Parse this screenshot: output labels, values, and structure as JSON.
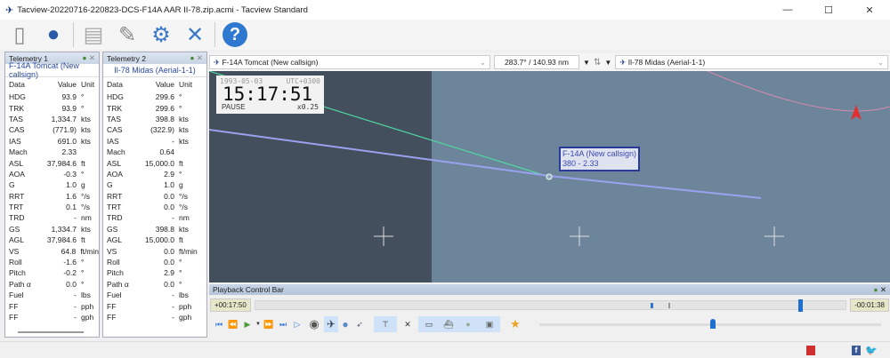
{
  "window": {
    "title": "Tacview-20220716-220823-DCS-F14A AAR II-78.zip.acmi - Tacview Standard",
    "minimize": "—",
    "maximize": "☐",
    "close": "✕"
  },
  "toolbar": [
    {
      "icon": "usb-drive-icon",
      "glyph": "🗄"
    },
    {
      "icon": "globe-icon",
      "glyph": "🌐"
    },
    {
      "icon": "document-icon",
      "glyph": "📄"
    },
    {
      "icon": "notepad-icon",
      "glyph": "📝"
    },
    {
      "icon": "gear-icon",
      "glyph": "⚙"
    },
    {
      "icon": "tools-icon",
      "glyph": "🛠"
    },
    {
      "icon": "help-icon",
      "glyph": "?"
    }
  ],
  "telemetry": [
    {
      "title": "Telemetry 1",
      "object": "F-14A Tomcat (New callsign)",
      "cols": [
        "Data",
        "Value",
        "Unit"
      ],
      "rows": [
        [
          "HDG",
          "93.9",
          "°"
        ],
        [
          "TRK",
          "93.9",
          "°"
        ],
        [
          "TAS",
          "1,334.7",
          "kts"
        ],
        [
          "CAS",
          "(771.9)",
          "kts"
        ],
        [
          "IAS",
          "691.0",
          "kts"
        ],
        [
          "Mach",
          "2.33",
          ""
        ],
        [
          "ASL",
          "37,984.6",
          "ft"
        ],
        [
          "AOA",
          "-0.3",
          "°"
        ],
        [
          "G",
          "1.0",
          "g"
        ],
        [
          "RRT",
          "1.6",
          "°/s"
        ],
        [
          "TRT",
          "0.1",
          "°/s"
        ],
        [
          "TRD",
          "-",
          "nm"
        ],
        [
          "GS",
          "1,334.7",
          "kts"
        ],
        [
          "AGL",
          "37,984.6",
          "ft"
        ],
        [
          "VS",
          "64.8",
          "ft/min"
        ],
        [
          "Roll",
          "-1.6",
          "°"
        ],
        [
          "Pitch",
          "-0.2",
          "°"
        ],
        [
          "Path α",
          "0.0",
          "°"
        ],
        [
          "Fuel",
          "-",
          "lbs"
        ],
        [
          "FF",
          "-",
          "pph"
        ],
        [
          "FF",
          "-",
          "gph"
        ]
      ]
    },
    {
      "title": "Telemetry 2",
      "object": "Il-78 Midas (Aerial-1-1)",
      "cols": [
        "Data",
        "Value",
        "Unit"
      ],
      "rows": [
        [
          "HDG",
          "299.6",
          "°"
        ],
        [
          "TRK",
          "299.6",
          "°"
        ],
        [
          "TAS",
          "398.8",
          "kts"
        ],
        [
          "CAS",
          "(322.9)",
          "kts"
        ],
        [
          "IAS",
          "-",
          "kts"
        ],
        [
          "Mach",
          "0.64",
          ""
        ],
        [
          "ASL",
          "15,000.0",
          "ft"
        ],
        [
          "AOA",
          "2.9",
          "°"
        ],
        [
          "G",
          "1.0",
          "g"
        ],
        [
          "RRT",
          "0.0",
          "°/s"
        ],
        [
          "TRT",
          "0.0",
          "°/s"
        ],
        [
          "TRD",
          "-",
          "nm"
        ],
        [
          "GS",
          "398.8",
          "kts"
        ],
        [
          "AGL",
          "15,000.0",
          "ft"
        ],
        [
          "VS",
          "0.0",
          "ft/min"
        ],
        [
          "Roll",
          "0.0",
          "°"
        ],
        [
          "Pitch",
          "2.9",
          "°"
        ],
        [
          "Path α",
          "0.0",
          "°"
        ],
        [
          "Fuel",
          "-",
          "lbs"
        ],
        [
          "FF",
          "-",
          "pph"
        ],
        [
          "FF",
          "-",
          "gph"
        ]
      ]
    }
  ],
  "selector": {
    "primary": "F-14A Tomcat (New callsign)",
    "bearing": "283.7° / 140.93 nm",
    "secondary": "Il-78 Midas (Aerial-1-1)"
  },
  "clock": {
    "date": "1993-05-03",
    "tz": "UTC+0300",
    "time": "15:17:51",
    "state": "PAUSE",
    "speed": "x0.25"
  },
  "label": {
    "name": "F-14A (New callsign)",
    "info": "380 - 2.33"
  },
  "playback": {
    "title": "Playback Control Bar",
    "elapsed": "+00:17:50",
    "remaining": "-00:01:38",
    "progress": 0.92,
    "speed_slider": 0.5
  }
}
